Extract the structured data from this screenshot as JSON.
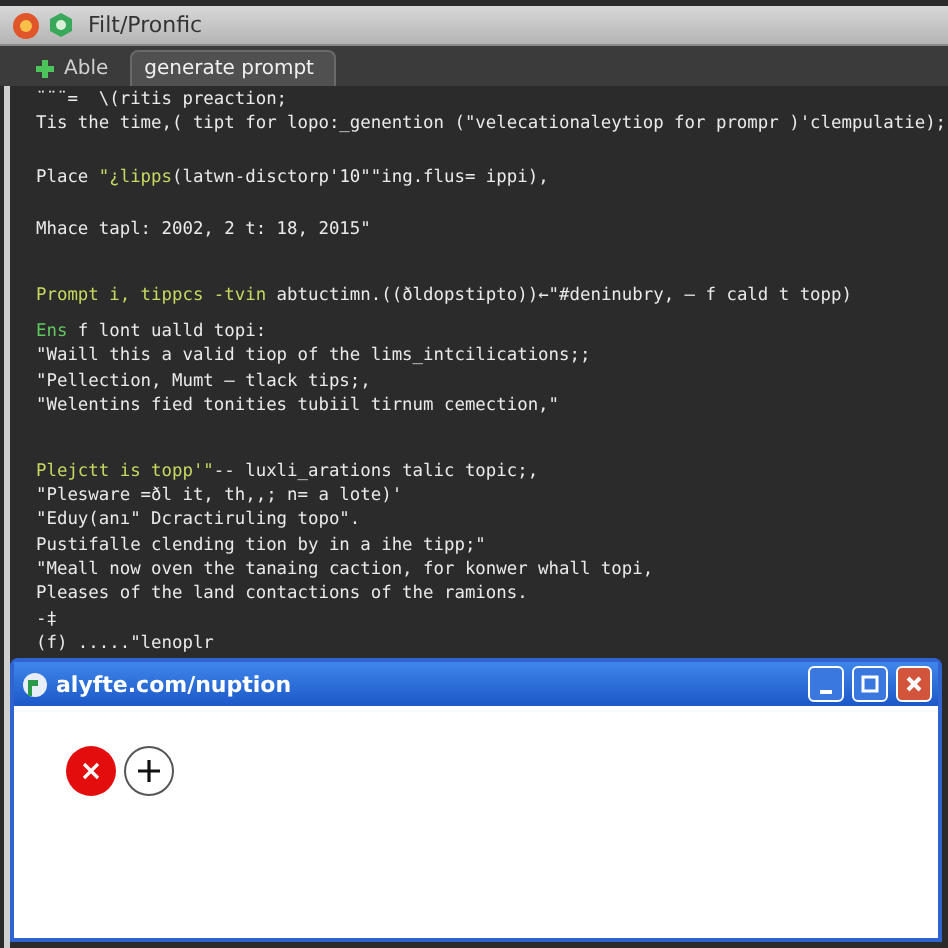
{
  "window": {
    "title": "Filt/Pronfic"
  },
  "tabs": [
    {
      "label": "Able",
      "selected": false
    },
    {
      "label": "generate prompt",
      "selected": true
    }
  ],
  "editor": {
    "lines": [
      {
        "kind": "code",
        "segments": [
          {
            "kind": "plain",
            "text": "¨¨¨=  \\(ritis preaction;"
          }
        ]
      },
      {
        "kind": "code",
        "segments": [
          {
            "kind": "plain",
            "text": "Tis the time,( tipt for lopo:_genention (\"velecationaleytiop for prompr )'clempulatie);"
          }
        ]
      },
      {
        "kind": "blank"
      },
      {
        "kind": "code",
        "segments": [
          {
            "kind": "plain",
            "text": "Place "
          },
          {
            "kind": "string",
            "text": "\"¿lipps"
          },
          {
            "kind": "plain",
            "text": "(latwn-disctorp'10\"\"ing.flus= ippi),"
          }
        ]
      },
      {
        "kind": "blank"
      },
      {
        "kind": "code",
        "segments": [
          {
            "kind": "plain",
            "text": "Mhace tapl: 2002, 2 t: 18, 2015\""
          }
        ]
      },
      {
        "kind": "blank"
      },
      {
        "kind": "gap"
      },
      {
        "kind": "code",
        "segments": [
          {
            "kind": "string",
            "text": "Prompt i, tippcs -tvin"
          },
          {
            "kind": "plain",
            "text": " abtuctimn.((ðldopstipto))←\"#deninubry, – f cald t topp)"
          }
        ]
      },
      {
        "kind": "gap"
      },
      {
        "kind": "code",
        "segments": [
          {
            "kind": "keyword",
            "text": "Ens"
          },
          {
            "kind": "plain",
            "text": " f lont ualld topi:"
          }
        ]
      },
      {
        "kind": "code",
        "segments": [
          {
            "kind": "plain",
            "text": "\"Waill this a valid tiop of the lims_intcilications;;"
          }
        ]
      },
      {
        "kind": "code",
        "segments": [
          {
            "kind": "plain",
            "text": "\"Pellection, Mumt – tlack tips;,"
          }
        ]
      },
      {
        "kind": "code",
        "segments": [
          {
            "kind": "plain",
            "text": "\"Welentins fied tonities tubiil tirnum cemection,\""
          }
        ]
      },
      {
        "kind": "blank"
      },
      {
        "kind": "gap"
      },
      {
        "kind": "code",
        "segments": [
          {
            "kind": "string",
            "text": "Plejctt is topp'\""
          },
          {
            "kind": "plain",
            "text": "-- luxli_arations talic topic;,"
          }
        ]
      },
      {
        "kind": "code",
        "segments": [
          {
            "kind": "plain",
            "text": "\"Plesware =ðl it, th,,; n= a lote)'"
          }
        ]
      },
      {
        "kind": "code",
        "segments": [
          {
            "kind": "plain",
            "text": "\"Eduy(anı\" Dcractiruling topo\"."
          }
        ]
      },
      {
        "kind": "code",
        "segments": [
          {
            "kind": "plain",
            "text": "Pustifalle clending tion by in a ihe tipp;\""
          }
        ]
      },
      {
        "kind": "code",
        "segments": [
          {
            "kind": "plain",
            "text": "\"Meall now oven the tanaing caction, for konwer whall topi,"
          }
        ]
      },
      {
        "kind": "code",
        "segments": [
          {
            "kind": "plain",
            "text": "Pleases of the land contactions of the ramions."
          }
        ]
      },
      {
        "kind": "code",
        "segments": [
          {
            "kind": "plain",
            "text": "-‡"
          }
        ]
      },
      {
        "kind": "code",
        "segments": [
          {
            "kind": "plain",
            "text": "(f) .....\"lenoplr"
          }
        ]
      }
    ]
  },
  "dialog": {
    "title": "alyfte.com/nuption"
  }
}
